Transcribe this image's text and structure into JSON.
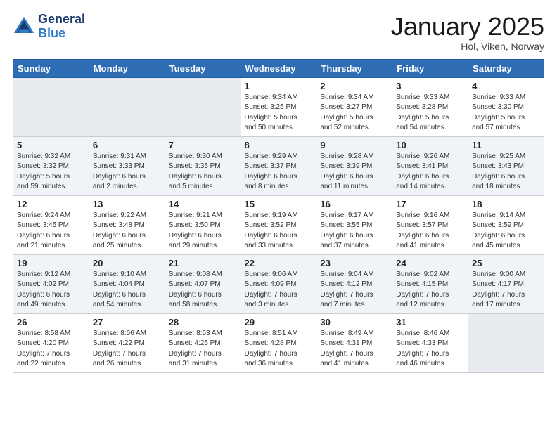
{
  "header": {
    "logo_line1": "General",
    "logo_line2": "Blue",
    "month_year": "January 2025",
    "location": "Hol, Viken, Norway"
  },
  "weekdays": [
    "Sunday",
    "Monday",
    "Tuesday",
    "Wednesday",
    "Thursday",
    "Friday",
    "Saturday"
  ],
  "weeks": [
    [
      {
        "day": "",
        "info": ""
      },
      {
        "day": "",
        "info": ""
      },
      {
        "day": "",
        "info": ""
      },
      {
        "day": "1",
        "info": "Sunrise: 9:34 AM\nSunset: 3:25 PM\nDaylight: 5 hours\nand 50 minutes."
      },
      {
        "day": "2",
        "info": "Sunrise: 9:34 AM\nSunset: 3:27 PM\nDaylight: 5 hours\nand 52 minutes."
      },
      {
        "day": "3",
        "info": "Sunrise: 9:33 AM\nSunset: 3:28 PM\nDaylight: 5 hours\nand 54 minutes."
      },
      {
        "day": "4",
        "info": "Sunrise: 9:33 AM\nSunset: 3:30 PM\nDaylight: 5 hours\nand 57 minutes."
      }
    ],
    [
      {
        "day": "5",
        "info": "Sunrise: 9:32 AM\nSunset: 3:32 PM\nDaylight: 5 hours\nand 59 minutes."
      },
      {
        "day": "6",
        "info": "Sunrise: 9:31 AM\nSunset: 3:33 PM\nDaylight: 6 hours\nand 2 minutes."
      },
      {
        "day": "7",
        "info": "Sunrise: 9:30 AM\nSunset: 3:35 PM\nDaylight: 6 hours\nand 5 minutes."
      },
      {
        "day": "8",
        "info": "Sunrise: 9:29 AM\nSunset: 3:37 PM\nDaylight: 6 hours\nand 8 minutes."
      },
      {
        "day": "9",
        "info": "Sunrise: 9:28 AM\nSunset: 3:39 PM\nDaylight: 6 hours\nand 11 minutes."
      },
      {
        "day": "10",
        "info": "Sunrise: 9:26 AM\nSunset: 3:41 PM\nDaylight: 6 hours\nand 14 minutes."
      },
      {
        "day": "11",
        "info": "Sunrise: 9:25 AM\nSunset: 3:43 PM\nDaylight: 6 hours\nand 18 minutes."
      }
    ],
    [
      {
        "day": "12",
        "info": "Sunrise: 9:24 AM\nSunset: 3:45 PM\nDaylight: 6 hours\nand 21 minutes."
      },
      {
        "day": "13",
        "info": "Sunrise: 9:22 AM\nSunset: 3:48 PM\nDaylight: 6 hours\nand 25 minutes."
      },
      {
        "day": "14",
        "info": "Sunrise: 9:21 AM\nSunset: 3:50 PM\nDaylight: 6 hours\nand 29 minutes."
      },
      {
        "day": "15",
        "info": "Sunrise: 9:19 AM\nSunset: 3:52 PM\nDaylight: 6 hours\nand 33 minutes."
      },
      {
        "day": "16",
        "info": "Sunrise: 9:17 AM\nSunset: 3:55 PM\nDaylight: 6 hours\nand 37 minutes."
      },
      {
        "day": "17",
        "info": "Sunrise: 9:16 AM\nSunset: 3:57 PM\nDaylight: 6 hours\nand 41 minutes."
      },
      {
        "day": "18",
        "info": "Sunrise: 9:14 AM\nSunset: 3:59 PM\nDaylight: 6 hours\nand 45 minutes."
      }
    ],
    [
      {
        "day": "19",
        "info": "Sunrise: 9:12 AM\nSunset: 4:02 PM\nDaylight: 6 hours\nand 49 minutes."
      },
      {
        "day": "20",
        "info": "Sunrise: 9:10 AM\nSunset: 4:04 PM\nDaylight: 6 hours\nand 54 minutes."
      },
      {
        "day": "21",
        "info": "Sunrise: 9:08 AM\nSunset: 4:07 PM\nDaylight: 6 hours\nand 58 minutes."
      },
      {
        "day": "22",
        "info": "Sunrise: 9:06 AM\nSunset: 4:09 PM\nDaylight: 7 hours\nand 3 minutes."
      },
      {
        "day": "23",
        "info": "Sunrise: 9:04 AM\nSunset: 4:12 PM\nDaylight: 7 hours\nand 7 minutes."
      },
      {
        "day": "24",
        "info": "Sunrise: 9:02 AM\nSunset: 4:15 PM\nDaylight: 7 hours\nand 12 minutes."
      },
      {
        "day": "25",
        "info": "Sunrise: 9:00 AM\nSunset: 4:17 PM\nDaylight: 7 hours\nand 17 minutes."
      }
    ],
    [
      {
        "day": "26",
        "info": "Sunrise: 8:58 AM\nSunset: 4:20 PM\nDaylight: 7 hours\nand 22 minutes."
      },
      {
        "day": "27",
        "info": "Sunrise: 8:56 AM\nSunset: 4:22 PM\nDaylight: 7 hours\nand 26 minutes."
      },
      {
        "day": "28",
        "info": "Sunrise: 8:53 AM\nSunset: 4:25 PM\nDaylight: 7 hours\nand 31 minutes."
      },
      {
        "day": "29",
        "info": "Sunrise: 8:51 AM\nSunset: 4:28 PM\nDaylight: 7 hours\nand 36 minutes."
      },
      {
        "day": "30",
        "info": "Sunrise: 8:49 AM\nSunset: 4:31 PM\nDaylight: 7 hours\nand 41 minutes."
      },
      {
        "day": "31",
        "info": "Sunrise: 8:46 AM\nSunset: 4:33 PM\nDaylight: 7 hours\nand 46 minutes."
      },
      {
        "day": "",
        "info": ""
      }
    ]
  ]
}
